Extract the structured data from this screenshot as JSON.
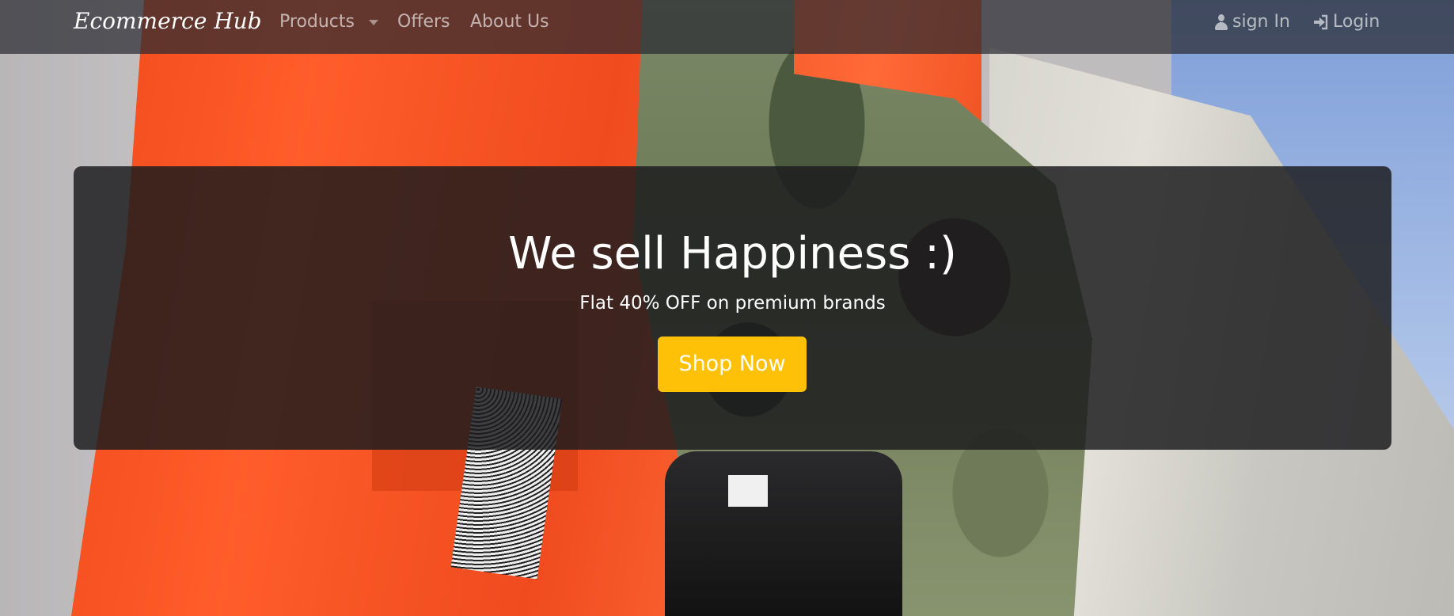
{
  "navbar": {
    "brand": "Ecommerce Hub",
    "links": {
      "products": "Products",
      "offers": "Offers",
      "about": "About Us"
    },
    "right": {
      "sign_in": "sign In",
      "login": "Login"
    }
  },
  "hero": {
    "title": "We sell Happiness :)",
    "subtitle": "Flat 40% OFF on premium brands",
    "cta": "Shop Now"
  },
  "colors": {
    "cta": "#ffc107",
    "navbar": "#282a30",
    "card": "#1c1c1e"
  },
  "icons": {
    "sign_in": "user-icon",
    "login": "sign-in-arrow-icon",
    "products": "caret-down-icon"
  }
}
